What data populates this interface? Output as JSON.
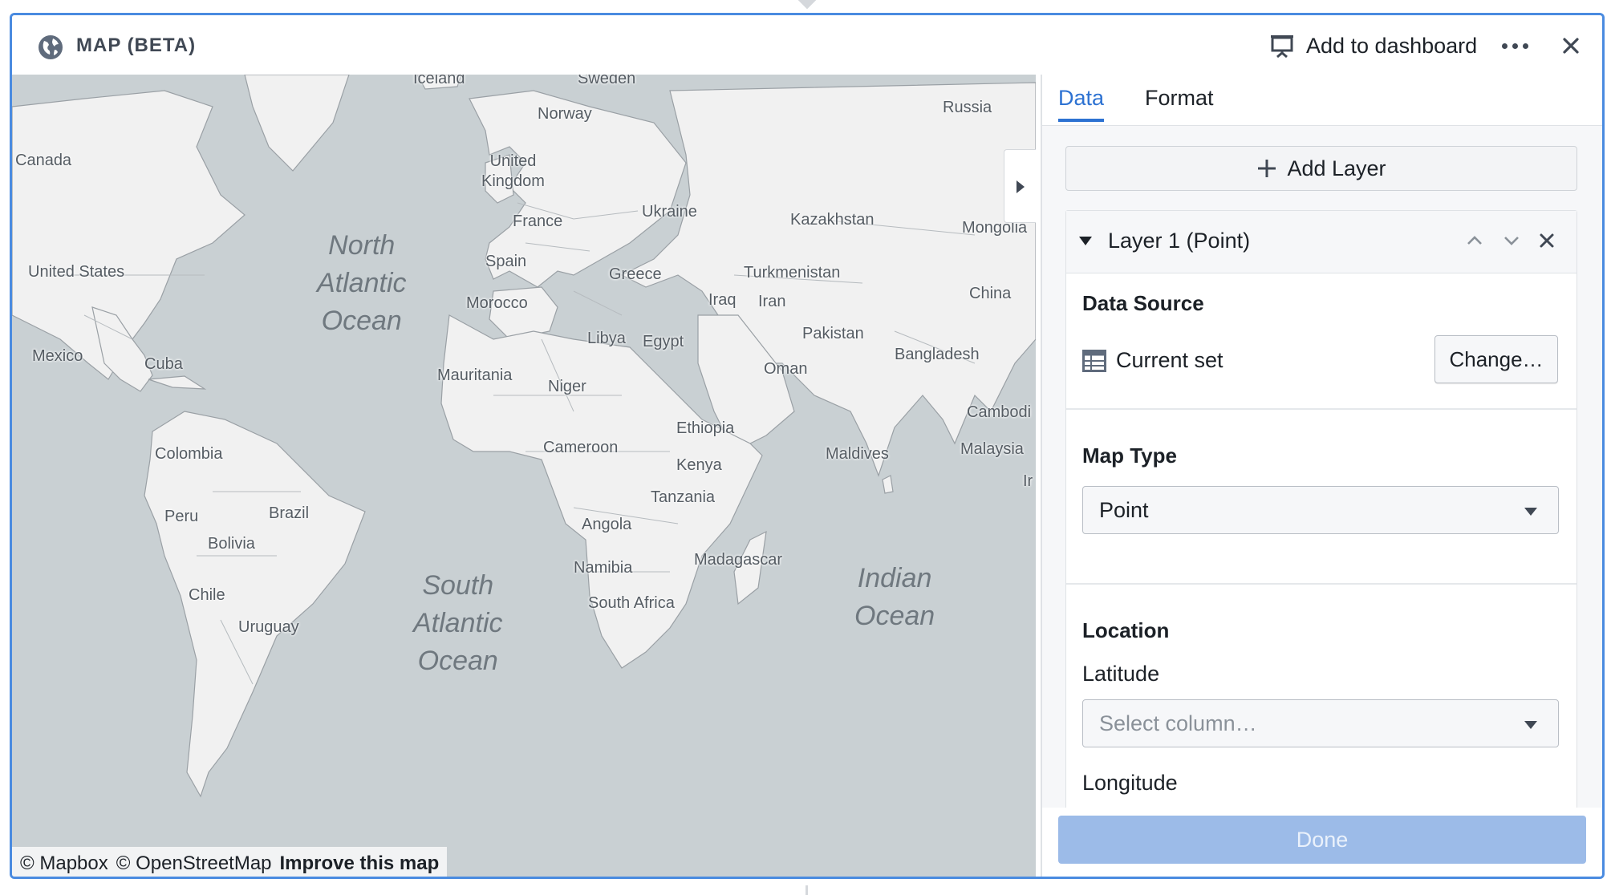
{
  "header": {
    "title": "MAP (BETA)",
    "add_to_dashboard": "Add to dashboard",
    "icons": {
      "app": "globe-icon",
      "dashboard": "presentation-icon",
      "more": "more-icon",
      "close": "close-icon"
    }
  },
  "map": {
    "attribution": {
      "mapbox": "© Mapbox",
      "osm": "© OpenStreetMap",
      "improve": "Improve this map"
    },
    "oceans": [
      {
        "name": "North\nAtlantic\nOcean"
      },
      {
        "name": "South\nAtlantic\nOcean"
      },
      {
        "name": "Indian\nOcean"
      }
    ],
    "labels": [
      "Iceland",
      "Sweden",
      "Norway",
      "Russia",
      "Canada",
      "United\nKingdom",
      "Ukraine",
      "France",
      "Kazakhstan",
      "Mongolia",
      "United States",
      "Spain",
      "Greece",
      "Turkmenistan",
      "China",
      "Iraq",
      "Iran",
      "Morocco",
      "Mexico",
      "Cuba",
      "Libya",
      "Egypt",
      "Pakistan",
      "Bangladesh",
      "Mauritania",
      "Niger",
      "Oman",
      "Cambodi",
      "Ethiopia",
      "Colombia",
      "Cameroon",
      "Maldives",
      "Malaysia",
      "Kenya",
      "Peru",
      "Brazil",
      "Tanzania",
      "Angola",
      "Bolivia",
      "Namibia",
      "Madagascar",
      "Chile",
      "South Africa",
      "Uruguay",
      "Ir"
    ]
  },
  "side_panel": {
    "tabs": [
      "Data",
      "Format"
    ],
    "active_tab": "Data",
    "add_layer": "Add Layer",
    "layer": {
      "title": "Layer 1 (Point)",
      "data_source": {
        "heading": "Data Source",
        "dataset": "Current set",
        "change": "Change…"
      },
      "map_type": {
        "heading": "Map Type",
        "value": "Point"
      },
      "location": {
        "heading": "Location",
        "latitude_label": "Latitude",
        "latitude_placeholder": "Select column…",
        "longitude_label": "Longitude"
      }
    },
    "done": "Done"
  },
  "colors": {
    "accent": "#2D72D2",
    "frame": "#4A8BE0",
    "water": "#C9D0D3",
    "land": "#F0F0F0",
    "done_disabled": "#9CBBE8"
  }
}
